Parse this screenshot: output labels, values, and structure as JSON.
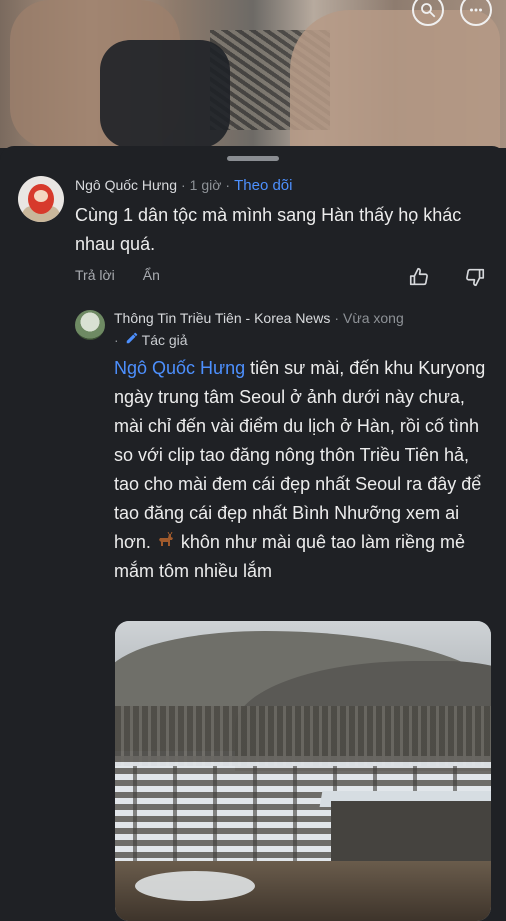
{
  "comment1": {
    "author": "Ngô Quốc Hưng",
    "time": "1 giờ",
    "follow_label": "Theo dõi",
    "text": "Cùng 1 dân tộc mà mình sang Hàn thấy họ khác nhau quá.",
    "reply_label": "Trả lời",
    "hide_label": "Ẩn"
  },
  "comment2": {
    "author": "Thông Tin Triều Tiên - Korea News",
    "time": "Vừa xong",
    "author_badge": "Tác giả",
    "mention": "Ngô Quốc Hưng",
    "text_before_emoji": " tiên sư mài, đến khu Kuryong ngày trung tâm Seoul ở ảnh dưới này chưa, mài chỉ đến vài điểm du lịch ở Hàn, rồi cố tình so với clip tao đăng nông thôn Triều Tiên hả, tao cho mài đem cái đẹp nhất Seoul ra đây để tao đăng cái đẹp nhất Bình Nhưỡng xem ai hơn. ",
    "text_after_emoji": " khôn như mài quê tao làm riềng mẻ mắm tôm nhiều lắm"
  },
  "icons": {
    "search": "search-icon",
    "more": "more-icon",
    "like": "thumbs-up-icon",
    "dislike": "thumbs-down-icon",
    "deer": "deer-emoji"
  },
  "colors": {
    "background": "#1f2125",
    "link": "#4d90fe",
    "text": "#ececec",
    "muted": "#8e9297"
  }
}
